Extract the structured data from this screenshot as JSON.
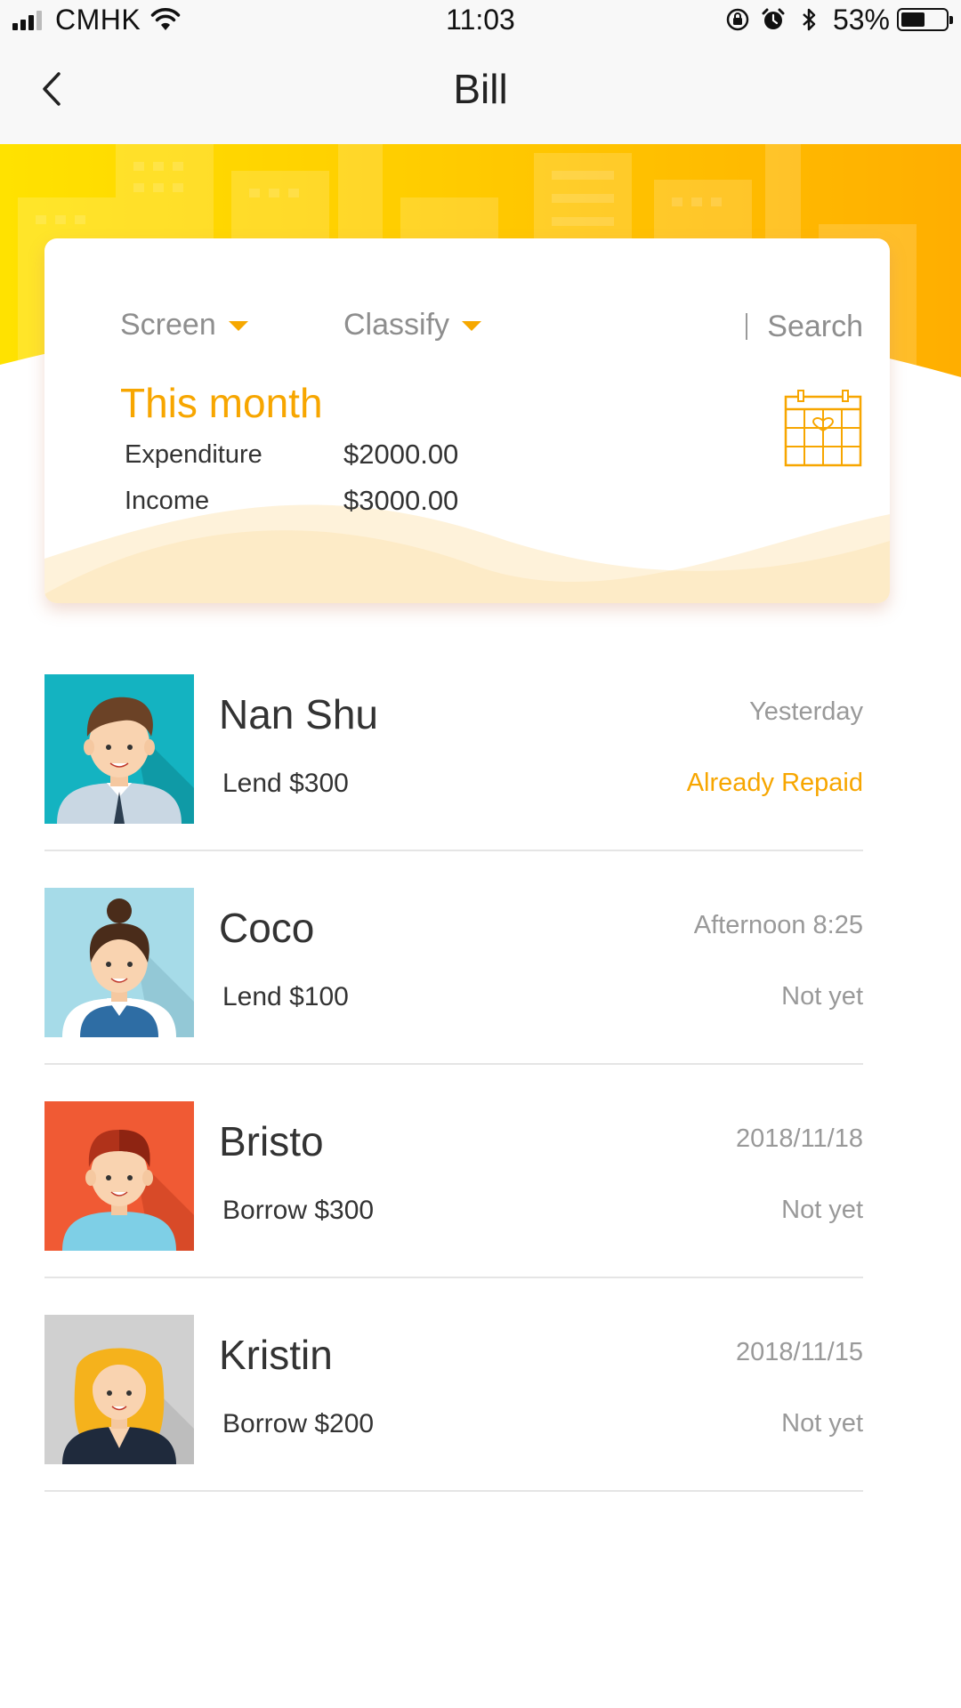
{
  "status_bar": {
    "carrier": "CMHK",
    "time": "11:03",
    "battery_percent": "53%",
    "battery_level": 0.53,
    "icons": [
      "signal-icon",
      "wifi-icon",
      "orientation-lock-icon",
      "alarm-icon",
      "bluetooth-icon",
      "battery-icon"
    ]
  },
  "nav": {
    "title": "Bill",
    "back_icon": "chevron-left-icon"
  },
  "colors": {
    "accent": "#f7a600",
    "banner_start": "#ffe200",
    "banner_end": "#ffae00"
  },
  "summary": {
    "filters": {
      "screen_label": "Screen",
      "classify_label": "Classify",
      "search_label": "Search"
    },
    "period_title": "This month",
    "expenditure_label": "Expenditure",
    "expenditure_value": "$2000.00",
    "income_label": "Income",
    "income_value": "$3000.00",
    "calendar_icon": "calendar-icon"
  },
  "transactions": [
    {
      "name": "Nan Shu",
      "detail": "Lend $300",
      "date": "Yesterday",
      "status": "Already Repaid",
      "status_type": "repaid"
    },
    {
      "name": "Coco",
      "detail": "Lend $100",
      "date": "Afternoon 8:25",
      "status": "Not yet",
      "status_type": "pending"
    },
    {
      "name": "Bristo",
      "detail": "Borrow $300",
      "date": "2018/11/18",
      "status": "Not yet",
      "status_type": "pending"
    },
    {
      "name": "Kristin",
      "detail": "Borrow $200",
      "date": "2018/11/15",
      "status": "Not yet",
      "status_type": "pending"
    }
  ]
}
